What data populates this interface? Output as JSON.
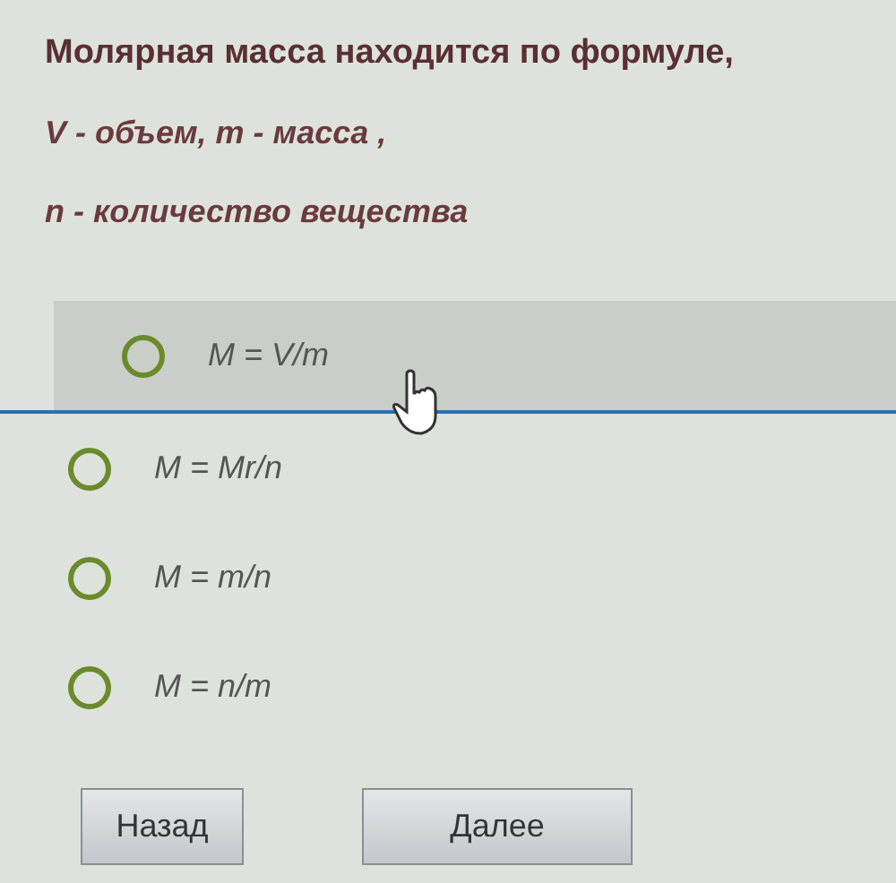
{
  "question": [
    "Молярная масса находится по формуле,",
    "V - объем, m - масса ,",
    "n - количество вещества"
  ],
  "options": [
    {
      "label": "M = V/m",
      "selected": false,
      "highlighted": true
    },
    {
      "label": "M = Mr/n",
      "selected": false,
      "highlighted": false
    },
    {
      "label": "M = m/n",
      "selected": false,
      "highlighted": false
    },
    {
      "label": "M = n/m",
      "selected": false,
      "highlighted": false
    }
  ],
  "buttons": [
    "Назад",
    "Далее"
  ]
}
